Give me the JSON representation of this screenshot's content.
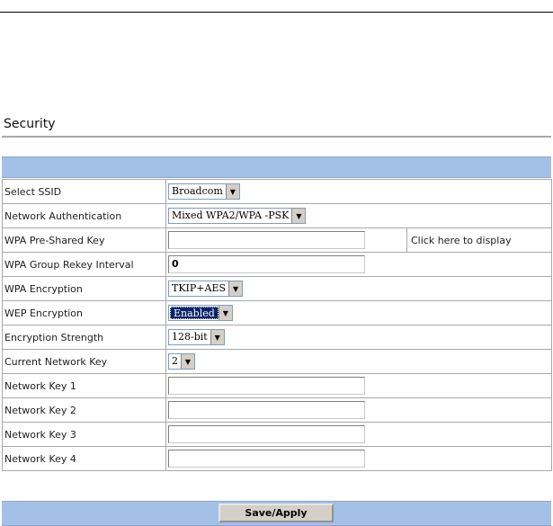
{
  "page": {
    "title": "Security"
  },
  "form": {
    "rows": [
      {
        "label": "Select SSID",
        "control": "select",
        "value": "Broadcom"
      },
      {
        "label": "Network Authentication",
        "control": "select",
        "value": "Mixed WPA2/WPA -PSK"
      },
      {
        "label": "WPA Pre-Shared Key",
        "control": "text",
        "value": "",
        "extra_link": "Click here to display"
      },
      {
        "label": "WPA Group Rekey Interval",
        "control": "text",
        "value": "0"
      },
      {
        "label": "WPA Encryption",
        "control": "select",
        "value": "TKIP+AES"
      },
      {
        "label": "WEP Encryption",
        "control": "select",
        "value": "Enabled",
        "focused": true
      },
      {
        "label": "Encryption Strength",
        "control": "select",
        "value": "128-bit"
      },
      {
        "label": "Current Network Key",
        "control": "select",
        "value": "2"
      },
      {
        "label": "Network Key 1",
        "control": "text",
        "value": ""
      },
      {
        "label": "Network Key 2",
        "control": "text",
        "value": ""
      },
      {
        "label": "Network Key 3",
        "control": "text",
        "value": ""
      },
      {
        "label": "Network Key 4",
        "control": "text",
        "value": ""
      }
    ]
  },
  "actions": {
    "save_label": "Save/Apply"
  },
  "icons": {
    "dropdown_arrow": "chevron-down-icon"
  },
  "colors": {
    "band": "#a3c0e6",
    "border": "#a9a9a9",
    "focus": "#0a246a"
  }
}
